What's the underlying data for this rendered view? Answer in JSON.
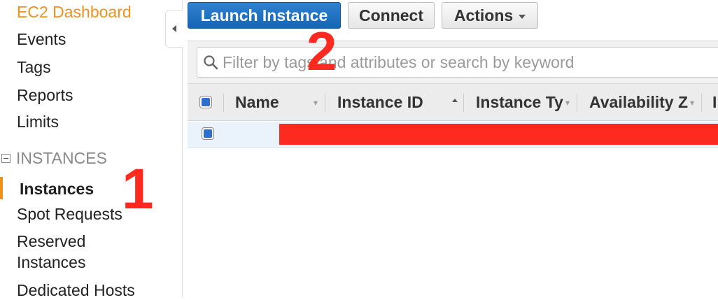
{
  "sidebar": {
    "dashboard": "EC2 Dashboard",
    "items_top": [
      "Events",
      "Tags",
      "Reports",
      "Limits"
    ],
    "section": "INSTANCES",
    "instances": "Instances",
    "spot_requests": "Spot Requests",
    "reserved_line1": "Reserved",
    "reserved_line2": "Instances",
    "dedicated_hosts": "Dedicated Hosts"
  },
  "toolbar": {
    "launch": "Launch Instance",
    "connect": "Connect",
    "actions": "Actions"
  },
  "filter": {
    "placeholder": "Filter by tags and attributes or search by keyword"
  },
  "table": {
    "columns": [
      "Name",
      "Instance ID",
      "Instance Ty",
      "Availability Z",
      "I"
    ]
  },
  "annotations": {
    "one": "1",
    "two": "2"
  },
  "colors": {
    "accent_orange": "#f0901f",
    "primary_blue": "#1f72c5",
    "annotation_red": "#ff2a1f"
  }
}
